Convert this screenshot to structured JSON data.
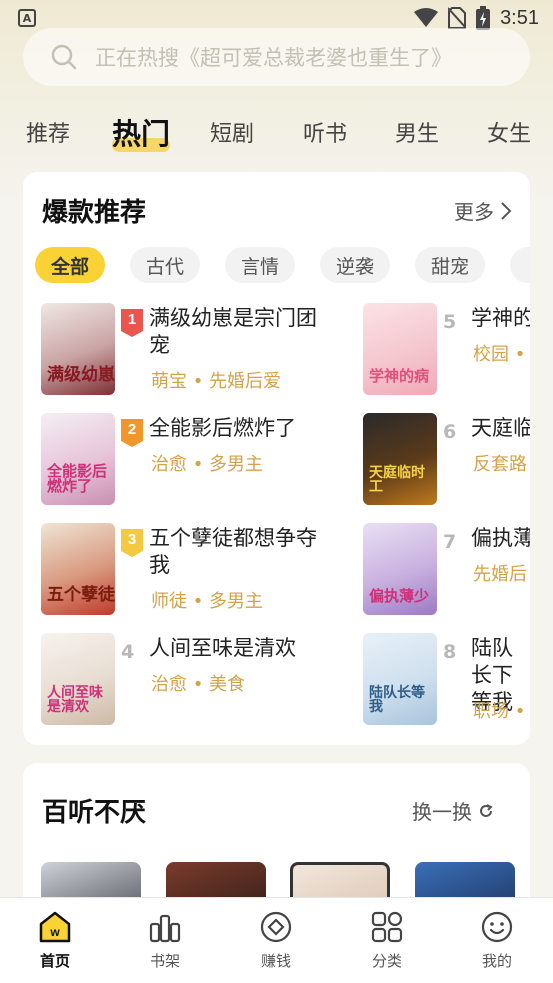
{
  "status": {
    "time": "3:51"
  },
  "search": {
    "placeholder": "正在热搜《超可爱总裁老婆也重生了》"
  },
  "tabs": [
    {
      "label": "推荐"
    },
    {
      "label": "热门"
    },
    {
      "label": "短剧"
    },
    {
      "label": "听书"
    },
    {
      "label": "男生"
    },
    {
      "label": "女生"
    }
  ],
  "hot_section": {
    "title": "爆款推荐",
    "more_label": "更多",
    "chips": [
      "全部",
      "古代",
      "言情",
      "逆袭",
      "甜宠"
    ],
    "books": [
      {
        "rank": "1",
        "title": "满级幼崽是宗门团宠",
        "tags": "萌宝 • 先婚后爱",
        "cover_text": "满级幼崽"
      },
      {
        "rank": "2",
        "title": "全能影后燃炸了",
        "tags": "治愈 • 多男主",
        "cover_text": "全能影后燃炸了"
      },
      {
        "rank": "3",
        "title": "五个孽徒都想争夺我",
        "tags": "师徒 • 多男主",
        "cover_text": "五个孽徒"
      },
      {
        "rank": "4",
        "title": "人间至味是清欢",
        "tags": "治愈 • 美食",
        "cover_text": "人间至味是清欢"
      },
      {
        "rank": "5",
        "title": "学神的",
        "tags": "校园 •",
        "cover_text": "学神的病"
      },
      {
        "rank": "6",
        "title": "天庭临",
        "tags": "反套路",
        "cover_text": "天庭临时工"
      },
      {
        "rank": "7",
        "title": "偏执薄",
        "tags": "先婚后",
        "cover_text": "偏执薄少"
      },
      {
        "rank": "8",
        "title": "陆队长下等我",
        "tags": "职场 •",
        "cover_text": "陆队长等我"
      }
    ]
  },
  "listen_section": {
    "title": "百听不厌",
    "refresh_label": "换一换"
  },
  "bottom_nav": [
    {
      "label": "首页",
      "icon": "home-icon"
    },
    {
      "label": "书架",
      "icon": "bookshelf-icon"
    },
    {
      "label": "赚钱",
      "icon": "earn-icon"
    },
    {
      "label": "分类",
      "icon": "category-icon"
    },
    {
      "label": "我的",
      "icon": "profile-icon"
    }
  ],
  "colors": {
    "accent": "#f9d236",
    "tag": "#d4a24a",
    "rank1": "#e8564e",
    "rank2": "#f0962c",
    "rank3": "#f3c940"
  }
}
